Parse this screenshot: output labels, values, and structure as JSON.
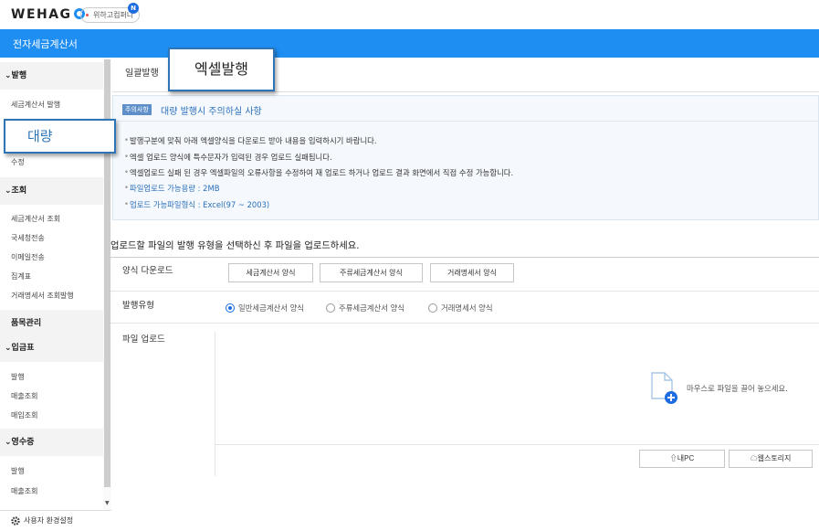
{
  "topbar": {
    "logo": "WEHAG",
    "company": "위하고컴퍼니",
    "badge": "N"
  },
  "header": {
    "title": "전자세금계산서"
  },
  "sidebar": {
    "sections": [
      {
        "title": "발행",
        "items": [
          "세금계산서 발행",
          "수정"
        ]
      },
      {
        "title": "조회",
        "items": [
          "세금계산서 조회",
          "국세청전송",
          "이메일전송",
          "집계표",
          "거래명세서 조회발행"
        ]
      },
      {
        "title": "품목관리",
        "items": []
      },
      {
        "title": "입금표",
        "items": [
          "발행",
          "매출조회",
          "매입조회"
        ]
      },
      {
        "title": "영수증",
        "items": [
          "발행",
          "매출조회"
        ]
      }
    ],
    "footer": "사용자 환경설정"
  },
  "overlays": {
    "excel": "엑셀발행",
    "bulk": "대량"
  },
  "tabs": {
    "first": "일괄발행"
  },
  "notice": {
    "tag": "주의사항",
    "title": "대량 발행시 주의하실 사항",
    "bullets": [
      "발행구분에 맞춰 아래 엑셀양식을 다운로드 받아 내용을 입력하시기 바랍니다.",
      "엑셀 업로드 양식에 특수문자가 입력된 경우 업로드 실패됩니다.",
      "엑셀업로드 실패 된 경우 엑셀파일의 오류사항을 수정하여 재 업로드 하거나 업로드 결과 화면에서 직접 수정 가능합니다.",
      "파일업로드 가능용량 : 2MB",
      "업로드 가능파일형식 : Excel(97 ~ 2003)"
    ]
  },
  "form": {
    "instruction": "업로드할 파일의 발행 유형을 선택하신 후 파일을 업로드하세요.",
    "download_label": "양식 다운로드",
    "download_buttons": [
      "세금계산서 양식",
      "주류세금계산서 양식",
      "거래명세서 양식"
    ],
    "type_label": "발행유형",
    "types": [
      "일반세금계산서 양식",
      "주류세금계산서 양식",
      "거래명세서 양식"
    ],
    "selected_type": "일반세금계산서 양식",
    "upload_label": "파일 업로드",
    "drop_text": "마우스로 파일을 끌어 놓으세요.",
    "upload_buttons": [
      "내PC",
      "웹스토리지"
    ]
  },
  "colors": {
    "header": "#1e8ef2",
    "accent": "#2f75b5",
    "link": "#2a6fba"
  }
}
